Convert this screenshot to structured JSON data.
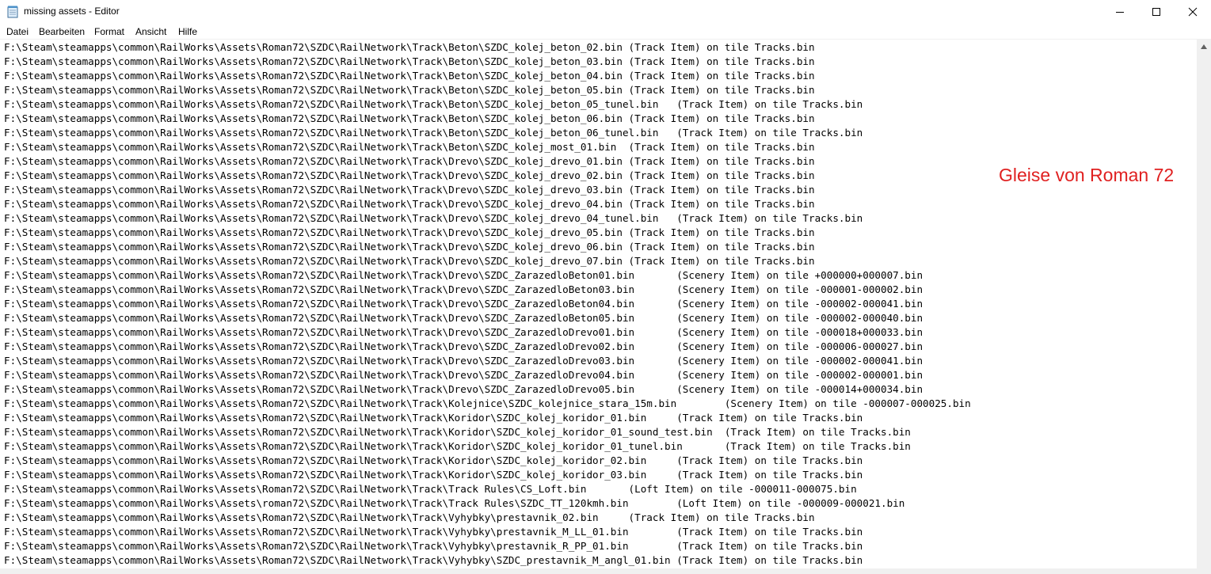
{
  "window": {
    "title": "missing assets - Editor",
    "icon": "notepad-icon",
    "controls": [
      "minimize-icon",
      "maximize-icon",
      "close-icon"
    ]
  },
  "menu": [
    "Datei",
    "Bearbeiten",
    "Format",
    "Ansicht",
    "Hilfe"
  ],
  "annotation": "Gleise von Roman 72",
  "lines": [
    "F:\\Steam\\steamapps\\common\\RailWorks\\Assets\\Roman72\\SZDC\\RailNetwork\\Track\\Beton\\SZDC_kolej_beton_02.bin (Track Item) on tile Tracks.bin",
    "F:\\Steam\\steamapps\\common\\RailWorks\\Assets\\Roman72\\SZDC\\RailNetwork\\Track\\Beton\\SZDC_kolej_beton_03.bin (Track Item) on tile Tracks.bin",
    "F:\\Steam\\steamapps\\common\\RailWorks\\Assets\\Roman72\\SZDC\\RailNetwork\\Track\\Beton\\SZDC_kolej_beton_04.bin (Track Item) on tile Tracks.bin",
    "F:\\Steam\\steamapps\\common\\RailWorks\\Assets\\Roman72\\SZDC\\RailNetwork\\Track\\Beton\\SZDC_kolej_beton_05.bin (Track Item) on tile Tracks.bin",
    "F:\\Steam\\steamapps\\common\\RailWorks\\Assets\\Roman72\\SZDC\\RailNetwork\\Track\\Beton\\SZDC_kolej_beton_05_tunel.bin   (Track Item) on tile Tracks.bin",
    "F:\\Steam\\steamapps\\common\\RailWorks\\Assets\\Roman72\\SZDC\\RailNetwork\\Track\\Beton\\SZDC_kolej_beton_06.bin (Track Item) on tile Tracks.bin",
    "F:\\Steam\\steamapps\\common\\RailWorks\\Assets\\Roman72\\SZDC\\RailNetwork\\Track\\Beton\\SZDC_kolej_beton_06_tunel.bin   (Track Item) on tile Tracks.bin",
    "F:\\Steam\\steamapps\\common\\RailWorks\\Assets\\Roman72\\SZDC\\RailNetwork\\Track\\Beton\\SZDC_kolej_most_01.bin  (Track Item) on tile Tracks.bin",
    "F:\\Steam\\steamapps\\common\\RailWorks\\Assets\\Roman72\\SZDC\\RailNetwork\\Track\\Drevo\\SZDC_kolej_drevo_01.bin (Track Item) on tile Tracks.bin",
    "F:\\Steam\\steamapps\\common\\RailWorks\\Assets\\Roman72\\SZDC\\RailNetwork\\Track\\Drevo\\SZDC_kolej_drevo_02.bin (Track Item) on tile Tracks.bin",
    "F:\\Steam\\steamapps\\common\\RailWorks\\Assets\\Roman72\\SZDC\\RailNetwork\\Track\\Drevo\\SZDC_kolej_drevo_03.bin (Track Item) on tile Tracks.bin",
    "F:\\Steam\\steamapps\\common\\RailWorks\\Assets\\Roman72\\SZDC\\RailNetwork\\Track\\Drevo\\SZDC_kolej_drevo_04.bin (Track Item) on tile Tracks.bin",
    "F:\\Steam\\steamapps\\common\\RailWorks\\Assets\\Roman72\\SZDC\\RailNetwork\\Track\\Drevo\\SZDC_kolej_drevo_04_tunel.bin   (Track Item) on tile Tracks.bin",
    "F:\\Steam\\steamapps\\common\\RailWorks\\Assets\\Roman72\\SZDC\\RailNetwork\\Track\\Drevo\\SZDC_kolej_drevo_05.bin (Track Item) on tile Tracks.bin",
    "F:\\Steam\\steamapps\\common\\RailWorks\\Assets\\Roman72\\SZDC\\RailNetwork\\Track\\Drevo\\SZDC_kolej_drevo_06.bin (Track Item) on tile Tracks.bin",
    "F:\\Steam\\steamapps\\common\\RailWorks\\Assets\\Roman72\\SZDC\\RailNetwork\\Track\\Drevo\\SZDC_kolej_drevo_07.bin (Track Item) on tile Tracks.bin",
    "F:\\Steam\\steamapps\\common\\RailWorks\\Assets\\Roman72\\SZDC\\RailNetwork\\Track\\Drevo\\SZDC_ZarazedloBeton01.bin       (Scenery Item) on tile +000000+000007.bin",
    "F:\\Steam\\steamapps\\common\\RailWorks\\Assets\\Roman72\\SZDC\\RailNetwork\\Track\\Drevo\\SZDC_ZarazedloBeton03.bin       (Scenery Item) on tile -000001-000002.bin",
    "F:\\Steam\\steamapps\\common\\RailWorks\\Assets\\Roman72\\SZDC\\RailNetwork\\Track\\Drevo\\SZDC_ZarazedloBeton04.bin       (Scenery Item) on tile -000002-000041.bin",
    "F:\\Steam\\steamapps\\common\\RailWorks\\Assets\\Roman72\\SZDC\\RailNetwork\\Track\\Drevo\\SZDC_ZarazedloBeton05.bin       (Scenery Item) on tile -000002-000040.bin",
    "F:\\Steam\\steamapps\\common\\RailWorks\\Assets\\Roman72\\SZDC\\RailNetwork\\Track\\Drevo\\SZDC_ZarazedloDrevo01.bin       (Scenery Item) on tile -000018+000033.bin",
    "F:\\Steam\\steamapps\\common\\RailWorks\\Assets\\Roman72\\SZDC\\RailNetwork\\Track\\Drevo\\SZDC_ZarazedloDrevo02.bin       (Scenery Item) on tile -000006-000027.bin",
    "F:\\Steam\\steamapps\\common\\RailWorks\\Assets\\Roman72\\SZDC\\RailNetwork\\Track\\Drevo\\SZDC_ZarazedloDrevo03.bin       (Scenery Item) on tile -000002-000041.bin",
    "F:\\Steam\\steamapps\\common\\RailWorks\\Assets\\Roman72\\SZDC\\RailNetwork\\Track\\Drevo\\SZDC_ZarazedloDrevo04.bin       (Scenery Item) on tile -000002-000001.bin",
    "F:\\Steam\\steamapps\\common\\RailWorks\\Assets\\Roman72\\SZDC\\RailNetwork\\Track\\Drevo\\SZDC_ZarazedloDrevo05.bin       (Scenery Item) on tile -000014+000034.bin",
    "F:\\Steam\\steamapps\\common\\RailWorks\\Assets\\Roman72\\SZDC\\RailNetwork\\Track\\Kolejnice\\SZDC_kolejnice_stara_15m.bin        (Scenery Item) on tile -000007-000025.bin",
    "F:\\Steam\\steamapps\\common\\RailWorks\\Assets\\Roman72\\SZDC\\RailNetwork\\Track\\Koridor\\SZDC_kolej_koridor_01.bin     (Track Item) on tile Tracks.bin",
    "F:\\Steam\\steamapps\\common\\RailWorks\\Assets\\Roman72\\SZDC\\RailNetwork\\Track\\Koridor\\SZDC_kolej_koridor_01_sound_test.bin  (Track Item) on tile Tracks.bin",
    "F:\\Steam\\steamapps\\common\\RailWorks\\Assets\\Roman72\\SZDC\\RailNetwork\\Track\\Koridor\\SZDC_kolej_koridor_01_tunel.bin       (Track Item) on tile Tracks.bin",
    "F:\\Steam\\steamapps\\common\\RailWorks\\Assets\\Roman72\\SZDC\\RailNetwork\\Track\\Koridor\\SZDC_kolej_koridor_02.bin     (Track Item) on tile Tracks.bin",
    "F:\\Steam\\steamapps\\common\\RailWorks\\Assets\\Roman72\\SZDC\\RailNetwork\\Track\\Koridor\\SZDC_kolej_koridor_03.bin     (Track Item) on tile Tracks.bin",
    "F:\\Steam\\steamapps\\common\\RailWorks\\Assets\\Roman72\\SZDC\\RailNetwork\\Track\\Track Rules\\CS_Loft.bin       (Loft Item) on tile -000011-000075.bin",
    "F:\\Steam\\steamapps\\common\\RailWorks\\Assets\\roman72\\SZDC\\RailNetwork\\Track\\Track Rules\\SZDC_TT_120kmh.bin        (Loft Item) on tile -000009-000021.bin",
    "F:\\Steam\\steamapps\\common\\RailWorks\\Assets\\Roman72\\SZDC\\RailNetwork\\Track\\Vyhybky\\prestavnik_02.bin     (Track Item) on tile Tracks.bin",
    "F:\\Steam\\steamapps\\common\\RailWorks\\Assets\\Roman72\\SZDC\\RailNetwork\\Track\\Vyhybky\\prestavnik_M_LL_01.bin        (Track Item) on tile Tracks.bin",
    "F:\\Steam\\steamapps\\common\\RailWorks\\Assets\\Roman72\\SZDC\\RailNetwork\\Track\\Vyhybky\\prestavnik_R_PP_01.bin        (Track Item) on tile Tracks.bin",
    "F:\\Steam\\steamapps\\common\\RailWorks\\Assets\\Roman72\\SZDC\\RailNetwork\\Track\\Vyhybky\\SZDC_prestavnik_M_angl_01.bin (Track Item) on tile Tracks.bin"
  ]
}
